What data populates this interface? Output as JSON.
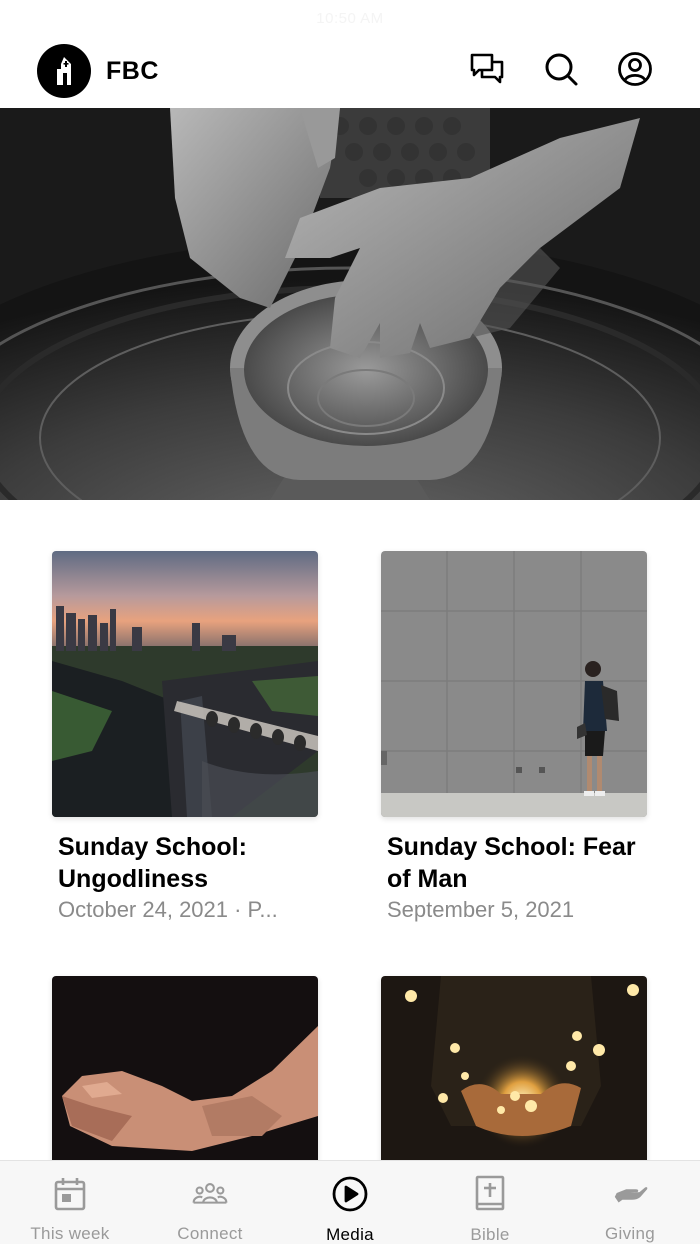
{
  "status_bar": {
    "time": "10:50 AM"
  },
  "header": {
    "app_title": "FBC",
    "logo_icon": "church-building-icon",
    "actions": [
      {
        "name": "chat",
        "icon": "chat-bubbles-icon"
      },
      {
        "name": "search",
        "icon": "search-icon"
      },
      {
        "name": "account",
        "icon": "account-circle-icon"
      }
    ]
  },
  "hero": {
    "image": "black-and-white photo of hands shaping clay pot on pottery wheel"
  },
  "media_items": [
    {
      "title": "Sunday School: Ungodliness",
      "meta": "October 24, 2021 · P...",
      "image": "city skyline with river and stone arch bridge at sunset"
    },
    {
      "title": "Sunday School: Fear of Man",
      "meta": "September 5, 2021",
      "image": "man with backpack standing before large gray concrete wall"
    },
    {
      "title": "",
      "meta": "",
      "image": "open cupped hands on dark background"
    },
    {
      "title": "",
      "meta": "",
      "image": "hands holding glowing string lights"
    }
  ],
  "tabs": [
    {
      "label": "This week",
      "icon": "calendar-icon",
      "active": false
    },
    {
      "label": "Connect",
      "icon": "people-group-icon",
      "active": false
    },
    {
      "label": "Media",
      "icon": "play-circle-icon",
      "active": true
    },
    {
      "label": "Bible",
      "icon": "bible-cross-icon",
      "active": false
    },
    {
      "label": "Giving",
      "icon": "giving-hand-icon",
      "active": false
    }
  ],
  "colors": {
    "active_tab": "#000000",
    "inactive_tab": "#9a9a9a",
    "meta_text": "#8a8a8a"
  }
}
